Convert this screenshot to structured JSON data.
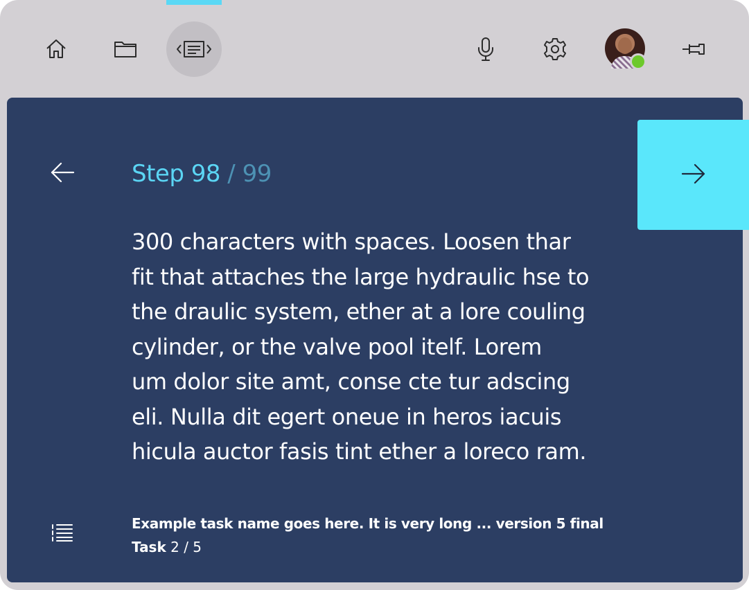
{
  "toolbar": {
    "items": [
      {
        "name": "home",
        "icon": "home-icon"
      },
      {
        "name": "folder",
        "icon": "folder-icon"
      },
      {
        "name": "guide",
        "icon": "guide-icon",
        "active": true
      },
      {
        "name": "microphone",
        "icon": "microphone-icon"
      },
      {
        "name": "settings",
        "icon": "gear-icon"
      },
      {
        "name": "user",
        "icon": "avatar",
        "presence": "online"
      },
      {
        "name": "pin",
        "icon": "pin-icon"
      }
    ]
  },
  "step": {
    "current": "Step 98",
    "separator": " / ",
    "total": "99"
  },
  "body": {
    "lines": [
      "300 characters with spaces.  Loosen thar",
      "fit that attaches the large hydraulic hse to",
      "the draulic system, ether at a lore couling",
      "cylinder, or the valve pool itelf.  Lorem",
      "um dolor site amt, conse cte tur adscing",
      "eli. Nulla dit egert oneue in heros iacuis",
      "hicula auctor fasis tint ether a loreco ram."
    ]
  },
  "task": {
    "name": "Example task name goes here. It is very long ... version 5 final",
    "label": "Task",
    "progress": "2 / 5"
  },
  "nav": {
    "back_icon": "arrow-left-icon",
    "next_icon": "arrow-right-icon",
    "task_list_icon": "task-list-icon"
  },
  "colors": {
    "frame": "#d3d0d4",
    "panel": "#2c3e63",
    "accent": "#5ae7fb",
    "step_current": "#5bd5f4",
    "step_total": "#4d92b4",
    "presence_online": "#6dc92c"
  }
}
